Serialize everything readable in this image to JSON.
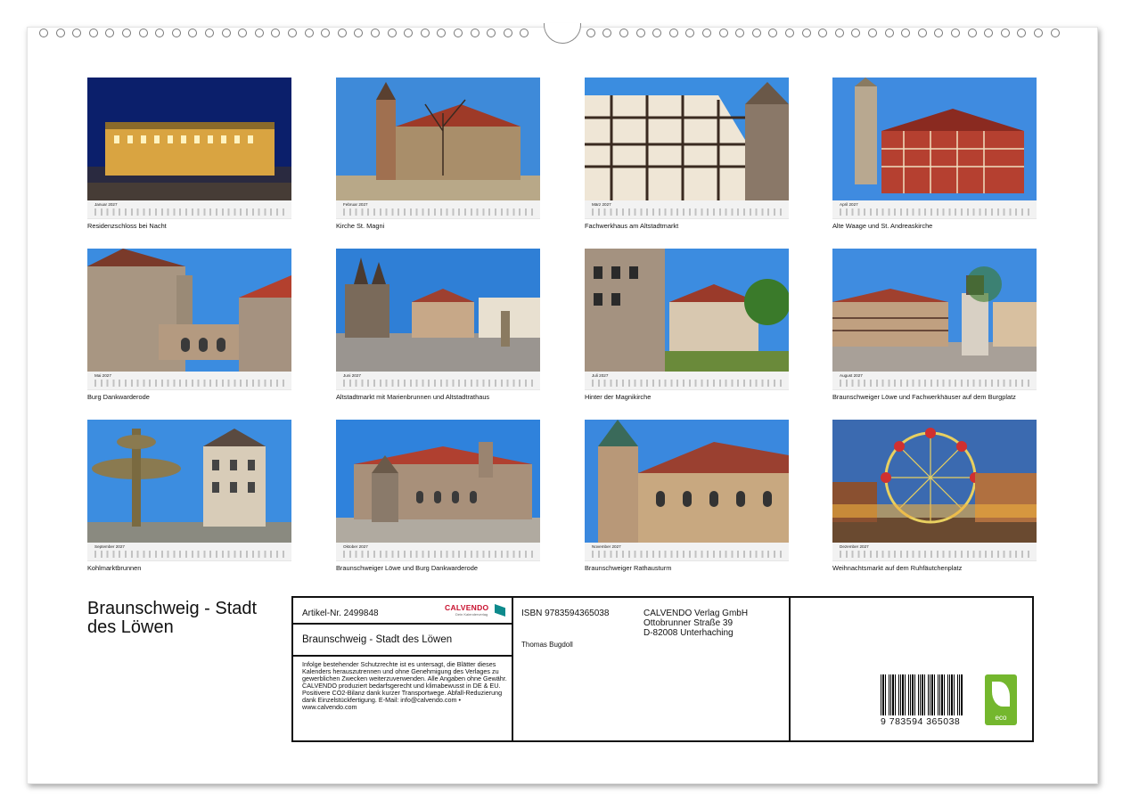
{
  "calendar_year": "2027",
  "months": [
    {
      "name": "Januar",
      "caption": "Residenzschloss bei Nacht"
    },
    {
      "name": "Februar",
      "caption": "Kirche St. Magni"
    },
    {
      "name": "März",
      "caption": "Fachwerkhaus am Altstadtmarkt"
    },
    {
      "name": "April",
      "caption": "Alte Waage und St. Andreaskirche"
    },
    {
      "name": "Mai",
      "caption": "Burg Dankwarderode"
    },
    {
      "name": "Juni",
      "caption": "Altstadtmarkt mit Marienbrunnen und Altstadtrathaus"
    },
    {
      "name": "Juli",
      "caption": "Hinter der Magnikirche"
    },
    {
      "name": "August",
      "caption": "Braunschweiger Löwe und Fachwerkhäuser auf dem Burgplatz"
    },
    {
      "name": "September",
      "caption": "Kohlmarktbrunnen"
    },
    {
      "name": "Oktober",
      "caption": "Braunschweiger Löwe und Burg Dankwarderode"
    },
    {
      "name": "November",
      "caption": "Braunschweiger Rathausturm"
    },
    {
      "name": "Dezember",
      "caption": "Weihnachtsmarkt auf dem Ruhfäutchenplatz"
    }
  ],
  "title": "Braunschweig - Stadt des Löwen",
  "info": {
    "article": "Artikel-Nr. 2499848",
    "logo_text": "CALVENDO",
    "logo_sub": "Dein Kalenderverlag",
    "subtitle": "Braunschweig - Stadt des Löwen",
    "legal": "Infolge bestehender Schutzrechte ist es untersagt, die Blätter dieses Kalenders herauszutrennen und ohne Genehmigung des Verlages zu gewerblichen Zwecken weiterzuverwenden. Alle Angaben ohne Gewähr. CALVENDO produziert bedarfsgerecht und klimabewusst in DE & EU. Positivere CO2-Bilanz dank kurzer Transportwege. Abfall-Reduzierung dank Einzelstückfertigung. E-Mail: info@calvendo.com • www.calvendo.com",
    "isbn": "ISBN 9783594365038",
    "author": "Thomas Bugdoll",
    "publisher_line1": "CALVENDO Verlag GmbH",
    "publisher_line2": "Ottobrunner Straße 39",
    "publisher_line3": "D-82008 Unterhaching",
    "barcode_number": "9 783594 365038",
    "eco_label": "eco"
  },
  "colors": {
    "sky": "#2f7fd6",
    "night": "#0b1f6b",
    "stone": "#9c8f7e",
    "roof": "#b5402e",
    "eco_green": "#74b72e",
    "calvendo_red": "#c8102e"
  }
}
